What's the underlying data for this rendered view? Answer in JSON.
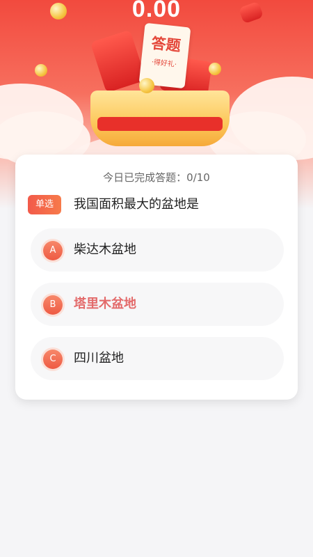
{
  "header": {
    "balance": "0.00",
    "banner_ticket_main": "答题",
    "banner_ticket_sub": "·得好礼·"
  },
  "quiz": {
    "progress_text": "今日已完成答题：0/10",
    "type_tag": "单选",
    "question": "我国面积最大的盆地是",
    "options": [
      {
        "letter": "A",
        "text": "柴达木盆地"
      },
      {
        "letter": "B",
        "text": "塔里木盆地"
      },
      {
        "letter": "C",
        "text": "四川盆地"
      }
    ]
  },
  "colors": {
    "accent": "#f24a3e",
    "selected_text": "#e36a6a",
    "badge": "#ee5a43"
  }
}
